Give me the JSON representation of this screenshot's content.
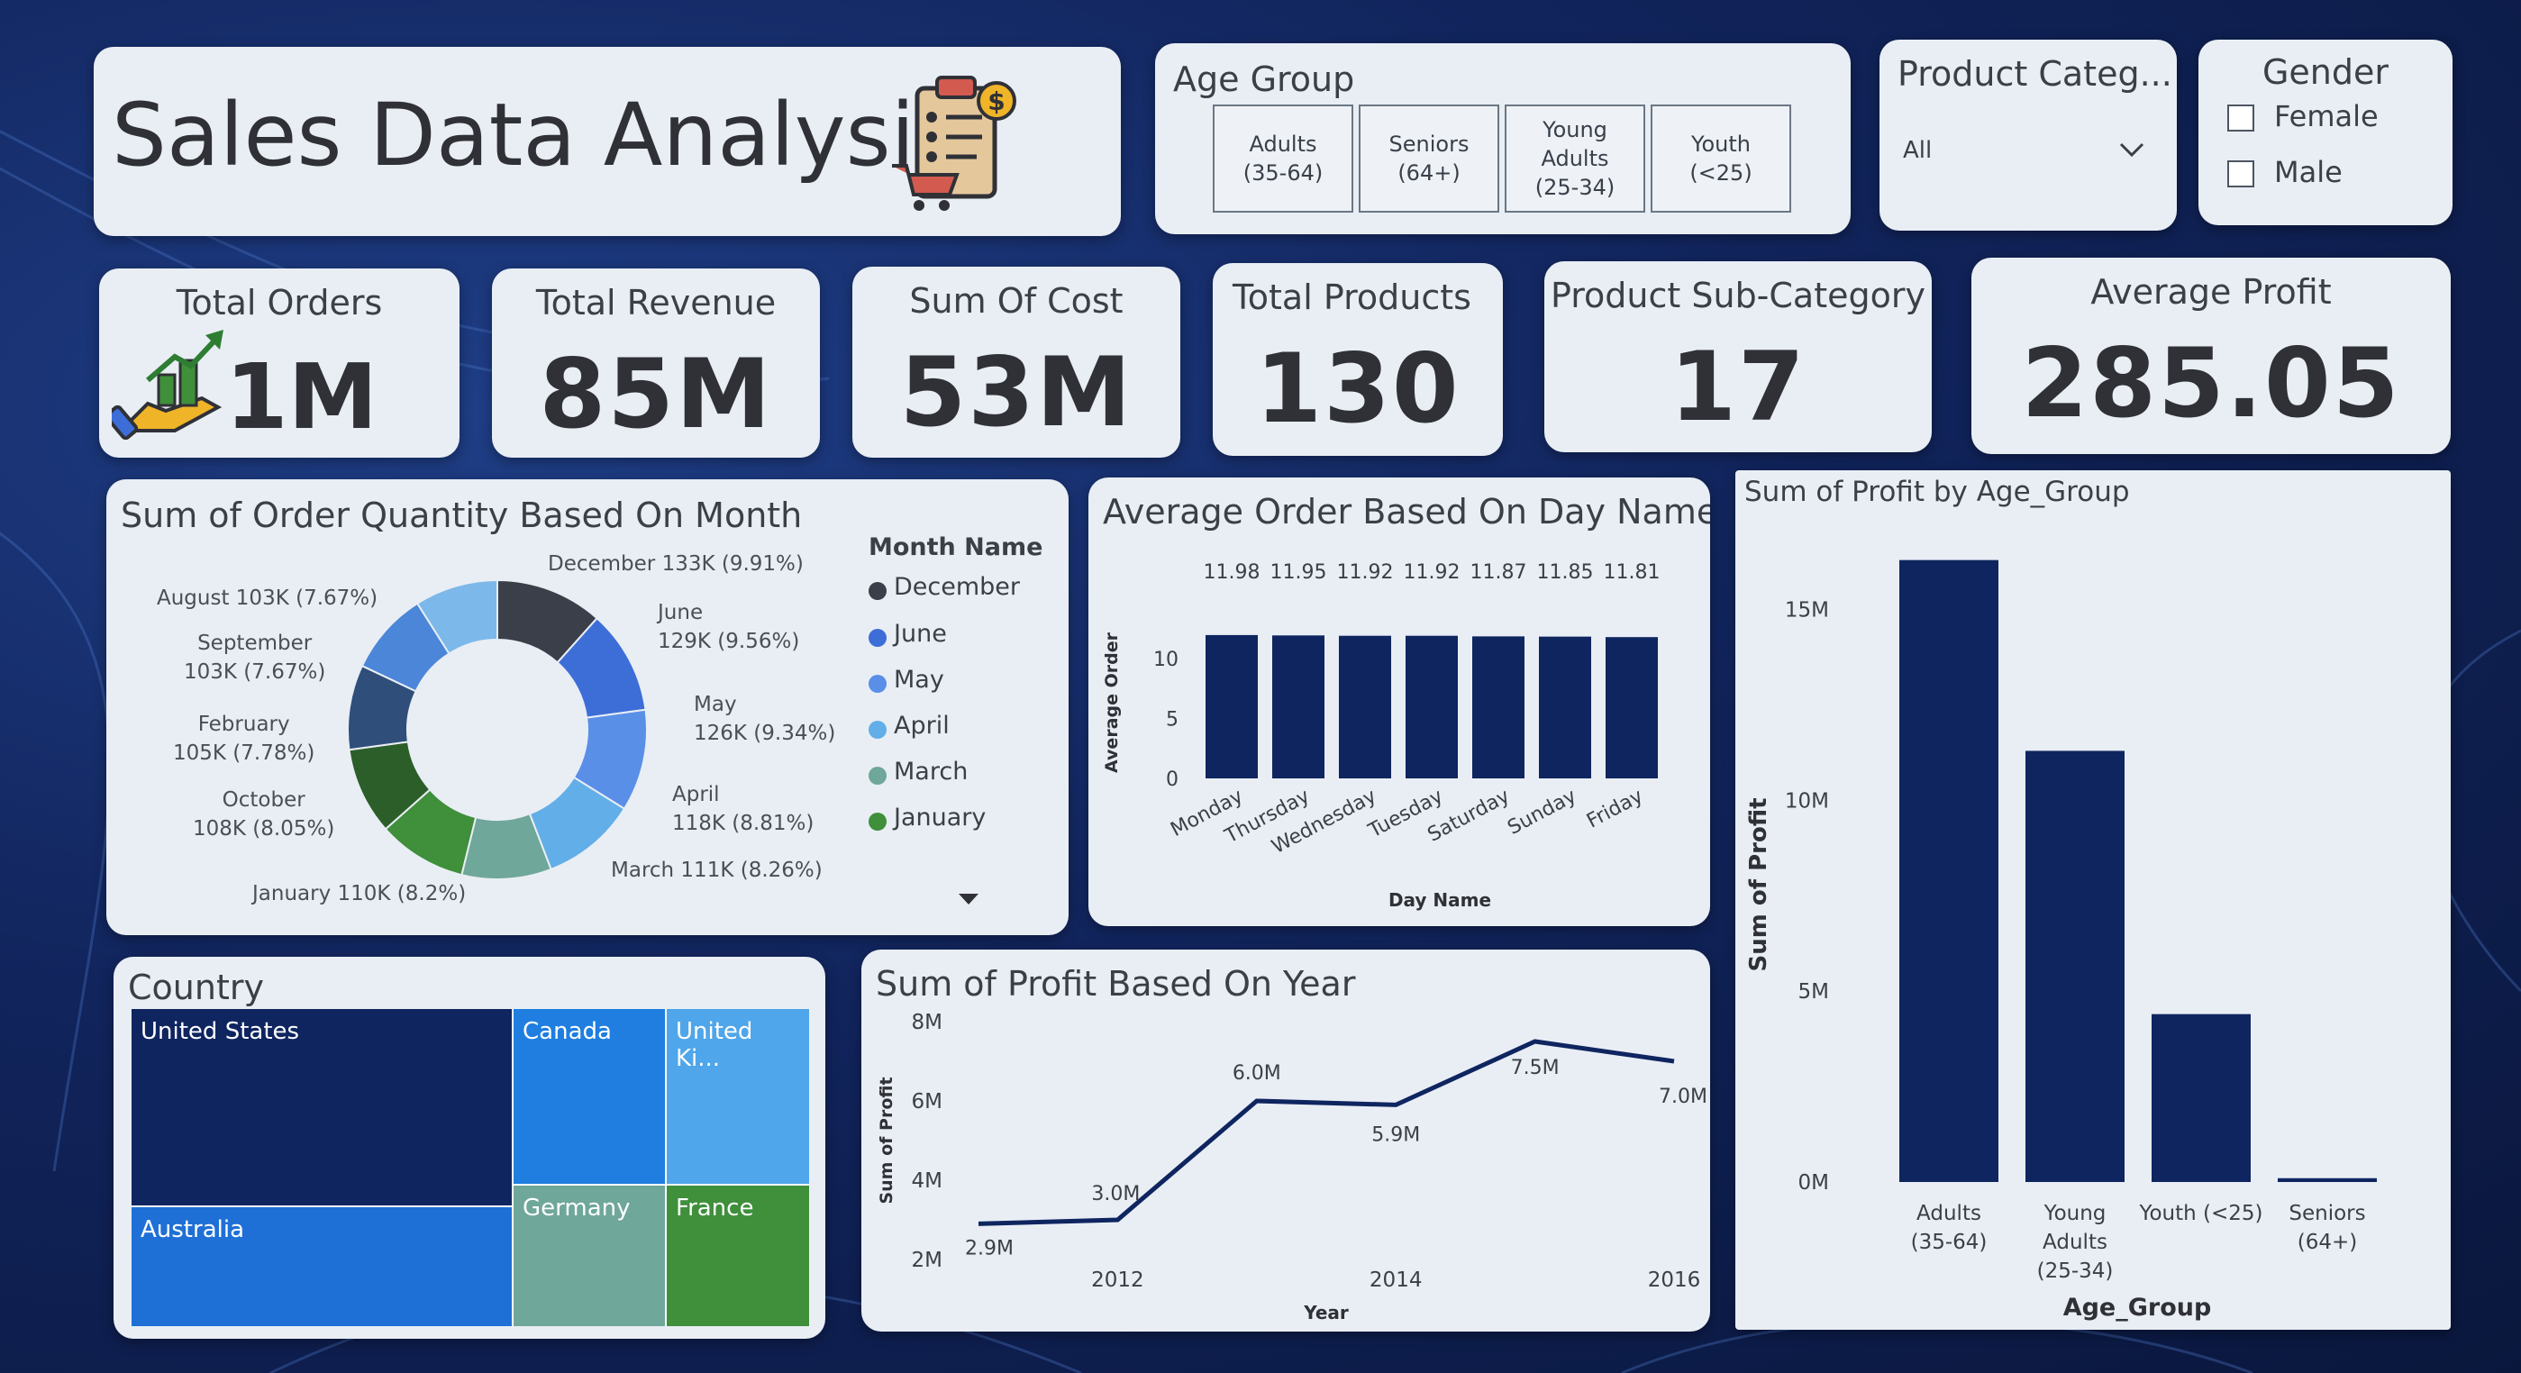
{
  "header": {
    "title": "Sales Data Analysis",
    "logo_icon": "clipboard-cart-dollar-icon"
  },
  "age_group": {
    "title": "Age Group",
    "options": [
      "Adults\n(35-64)",
      "Seniors\n(64+)",
      "Young\nAdults\n(25-34)",
      "Youth\n(<25)"
    ]
  },
  "product_category": {
    "title": "Product Categ...",
    "selected": "All"
  },
  "gender": {
    "title": "Gender",
    "options": [
      "Female",
      "Male"
    ]
  },
  "kpis": {
    "total_orders": {
      "label": "Total Orders",
      "value": "1M",
      "icon": "hand-growth-icon"
    },
    "total_revenue": {
      "label": "Total Revenue",
      "value": "85M"
    },
    "sum_of_cost": {
      "label": "Sum Of Cost",
      "value": "53M"
    },
    "total_products": {
      "label": "Total Products",
      "value": "130"
    },
    "product_sub_category": {
      "label": "Product Sub-Category",
      "value": "17"
    },
    "average_profit": {
      "label": "Average Profit",
      "value": "285.05"
    }
  },
  "colors": {
    "navy": "#0f2560",
    "bright_blue": "#1f7ee0",
    "light_blue": "#4fa6ea",
    "teal": "#6fa79a",
    "green": "#3f8f3b"
  },
  "chart_data": [
    {
      "type": "pie",
      "title": "Sum of Order Quantity Based On Month",
      "legend_title": "Month Name",
      "legend": [
        "December",
        "June",
        "May",
        "April",
        "March",
        "January"
      ],
      "legend_position": "right",
      "slices": [
        {
          "label": "December",
          "value": 133,
          "display": "December 133K (9.91%)"
        },
        {
          "label": "June",
          "value": 129,
          "display": "June\n129K (9.56%)"
        },
        {
          "label": "May",
          "value": 126,
          "display": "May\n126K (9.34%)"
        },
        {
          "label": "April",
          "value": 118,
          "display": "April\n118K (8.81%)"
        },
        {
          "label": "March",
          "value": 111,
          "display": "March 111K (8.26%)"
        },
        {
          "label": "January",
          "value": 110,
          "display": "January 110K (8.2%)"
        },
        {
          "label": "October",
          "value": 108,
          "display": "October\n108K (8.05%)"
        },
        {
          "label": "February",
          "value": 105,
          "display": "February\n105K (7.78%)"
        },
        {
          "label": "September",
          "value": 103,
          "display": "September\n103K (7.67%)"
        },
        {
          "label": "August",
          "value": 103,
          "display": "August 103K (7.67%)"
        }
      ]
    },
    {
      "type": "bar",
      "title": "Average Order Based On Day Name",
      "categories": [
        "Monday",
        "Thursday",
        "Wednesday",
        "Tuesday",
        "Saturday",
        "Sunday",
        "Friday"
      ],
      "values": [
        11.98,
        11.95,
        11.92,
        11.92,
        11.87,
        11.85,
        11.81
      ],
      "value_labels": [
        "11.98",
        "11.95",
        "11.92",
        "11.92",
        "11.87",
        "11.85",
        "11.81"
      ],
      "xlabel": "Day Name",
      "ylabel": "Average Order",
      "yticks": [
        "0",
        "5",
        "10"
      ],
      "ylim": [
        0,
        12.5
      ]
    },
    {
      "type": "table",
      "title": "Country",
      "cells": [
        "United States",
        "Canada",
        "United Ki...",
        "Australia",
        "Germany",
        "France"
      ]
    },
    {
      "type": "line",
      "title": "Sum of Profit Based On Year",
      "x": [
        2011,
        2012,
        2013,
        2014,
        2015,
        2016
      ],
      "values": [
        2.9,
        3.0,
        6.0,
        5.9,
        7.5,
        7.0
      ],
      "point_labels": [
        "2.9M",
        "3.0M",
        "6.0M",
        "5.9M",
        "7.5M",
        "7.0M"
      ],
      "xticks": [
        "2012",
        "2014",
        "2016"
      ],
      "yticks": [
        "2M",
        "4M",
        "6M",
        "8M"
      ],
      "xlabel": "Year",
      "ylabel": "Sum of Profit",
      "ylim": [
        2,
        8
      ]
    },
    {
      "type": "bar",
      "title": "Sum of Profit by Age_Group",
      "categories": [
        "Adults\n(35-64)",
        "Young\nAdults\n(25-34)",
        "Youth (<25)",
        "Seniors\n(64+)"
      ],
      "values": [
        16.3,
        11.3,
        4.4,
        0.1
      ],
      "xlabel": "Age_Group",
      "ylabel": "Sum of Profit",
      "yticks": [
        "0M",
        "5M",
        "10M",
        "15M"
      ],
      "ylim": [
        0,
        17
      ]
    }
  ]
}
